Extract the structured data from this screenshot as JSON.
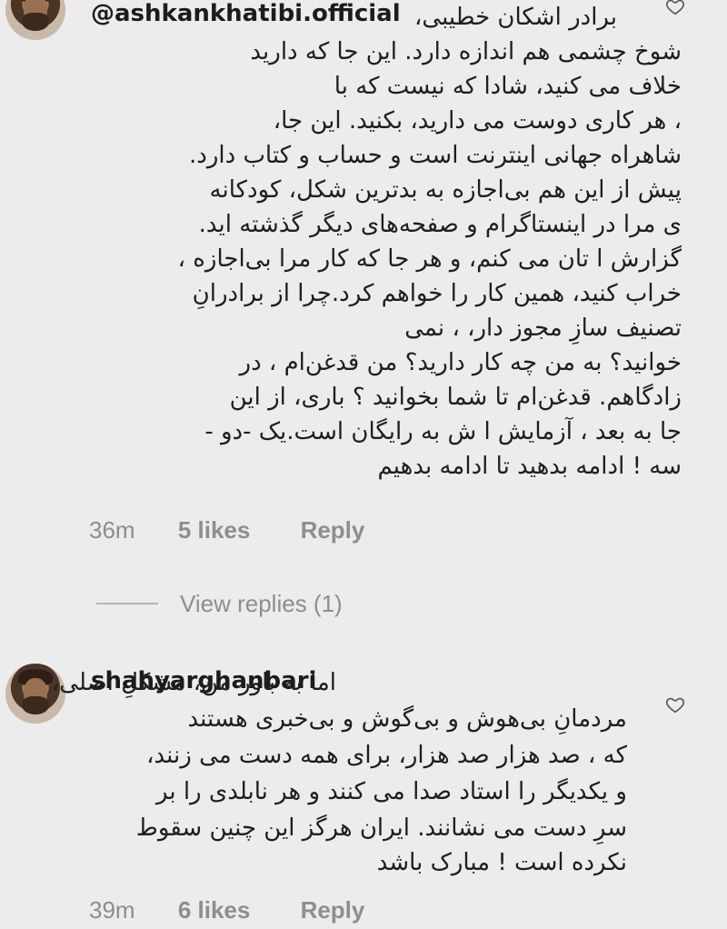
{
  "comment1": {
    "username": "@ashkankhatibi.official",
    "name_mention": "برادر اشکان خطیبی،",
    "lines": [
      "شوخ چشمی هم اندازه  دارد. این جا که دارید",
      "خلاف می کنید، شادا که              نیست که با",
      "، هر کاری دوست می دارید، بکنید. این جا،",
      "شاهراه جهانی اینترنت است و حساب و کتاب دارد.",
      "پیش از این هم بی‌اجازه به بدترین شکل، کودکانه",
      "ی مرا در اینستاگرام و صفحه‌های دیگر گذشته اید.",
      "گزارش ا تان می کنم، و هر جا که کار مرا بی‌اجازه ،",
      "خراب کنید، همین کار را خواهم کرد.چرا از برادرانِ",
      "تصنیف سازِ مجوز دار،                    ، نمی",
      "خوانید؟ به من چه کار دارید؟ من قدغن‌ام ، در",
      "زادگاهم. قدغن‌ام تا شما بخوانید ؟ باری، از این",
      "جا به بعد ،  آزمایش ا ش به رایگان است.یک -دو -",
      "سه ! ادامه بدهید تا ادامه بدهیم"
    ],
    "time": "36m",
    "likes": "5 likes",
    "reply": "Reply"
  },
  "view_replies": "View replies (1)",
  "comment2": {
    "username": "shahyarghanbari",
    "lines": [
      "اما به باور من، مشکلِ اصلی،",
      "مردمانِ بی‌هوش و بی‌گوش و بی‌خبری هستند",
      "که ، صد هزار صد هزار، برای همه دست می زنند،",
      "و یکدیگر را استاد صدا می کنند و هر نابلدی را بر",
      "سرِ دست می نشانند. ایران هرگز این چنین سقوط",
      "نکرده است ! مبارک باشد"
    ],
    "time": "39m",
    "likes": "6 likes",
    "reply": "Reply"
  },
  "icons": {
    "heart": "heart-outline-icon"
  },
  "colors": {
    "background": "#ececec",
    "meta_text": "#8e8e8e"
  }
}
